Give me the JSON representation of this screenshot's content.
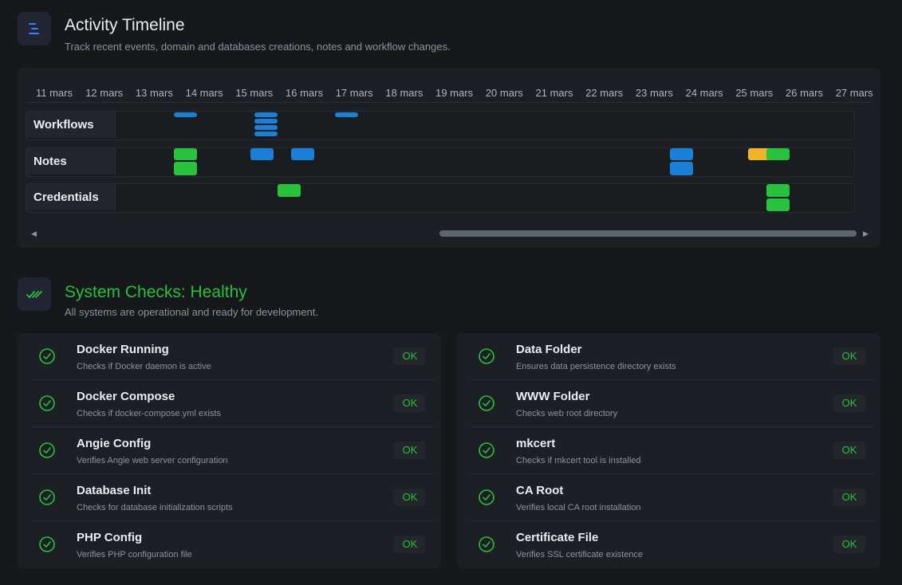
{
  "timeline": {
    "title": "Activity Timeline",
    "subtitle": "Track recent events, domain and databases creations, notes and workflow changes.",
    "dates": [
      "11 mars",
      "12 mars",
      "13 mars",
      "14 mars",
      "15 mars",
      "16 mars",
      "17 mars",
      "18 mars",
      "19 mars",
      "20 mars",
      "21 mars",
      "22 mars",
      "23 mars",
      "24 mars",
      "25 mars",
      "26 mars",
      "27 mars"
    ],
    "rows": [
      "Workflows",
      "Notes",
      "Credentials"
    ],
    "colors": {
      "blue": "#1a7fd6",
      "green": "#28c23d",
      "yellow": "#f2b32a"
    }
  },
  "system": {
    "title": "System Checks: Healthy",
    "subtitle": "All systems are operational and ready for development.",
    "accent": "#2bbf3f",
    "left": [
      {
        "name": "Docker Running",
        "desc": "Checks if Docker daemon is active",
        "status": "OK"
      },
      {
        "name": "Docker Compose",
        "desc": "Checks if docker-compose.yml exists",
        "status": "OK"
      },
      {
        "name": "Angie Config",
        "desc": "Verifies Angie web server configuration",
        "status": "OK"
      },
      {
        "name": "Database Init",
        "desc": "Checks for database initialization scripts",
        "status": "OK"
      },
      {
        "name": "PHP Config",
        "desc": "Verifies PHP configuration file",
        "status": "OK"
      }
    ],
    "right": [
      {
        "name": "Data Folder",
        "desc": "Ensures data persistence directory exists",
        "status": "OK"
      },
      {
        "name": "WWW Folder",
        "desc": "Checks web root directory",
        "status": "OK"
      },
      {
        "name": "mkcert",
        "desc": "Checks if mkcert tool is installed",
        "status": "OK"
      },
      {
        "name": "CA Root",
        "desc": "Verifies local CA root installation",
        "status": "OK"
      },
      {
        "name": "Certificate File",
        "desc": "Verifies SSL certificate existence",
        "status": "OK"
      }
    ]
  }
}
